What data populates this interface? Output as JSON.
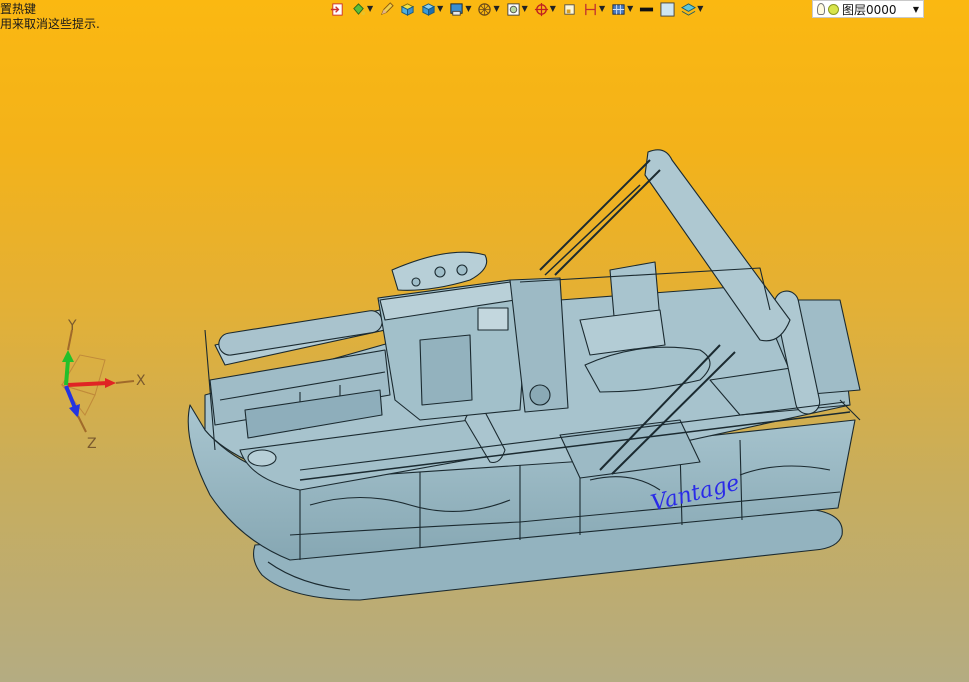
{
  "hints": {
    "line1": "置热键",
    "line2": "用来取消这些提示."
  },
  "toolbar": {
    "icons": [
      "import-icon",
      "paint-bucket-icon",
      "pencil-icon",
      "layer-cube-icon",
      "solid-view-icon",
      "render-icon",
      "wheel-icon",
      "picture-icon",
      "crosshair-icon",
      "small-box-icon",
      "dimension-icon",
      "grid-icon",
      "line-color-icon",
      "fill-color-icon",
      "layers-icon"
    ],
    "layer": {
      "label": "图层0000"
    }
  },
  "axes": {
    "x": "X",
    "y": "Y",
    "z": "Z"
  },
  "model": {
    "brand_text": "Vantage"
  },
  "colors": {
    "background_top": "#fbb811",
    "background_bottom": "#b4ac82",
    "model_fill": "#9fbec9",
    "model_stroke": "#1b2a30",
    "axis_x": "#e02424",
    "axis_y": "#22c02a",
    "axis_z": "#2434e0"
  }
}
